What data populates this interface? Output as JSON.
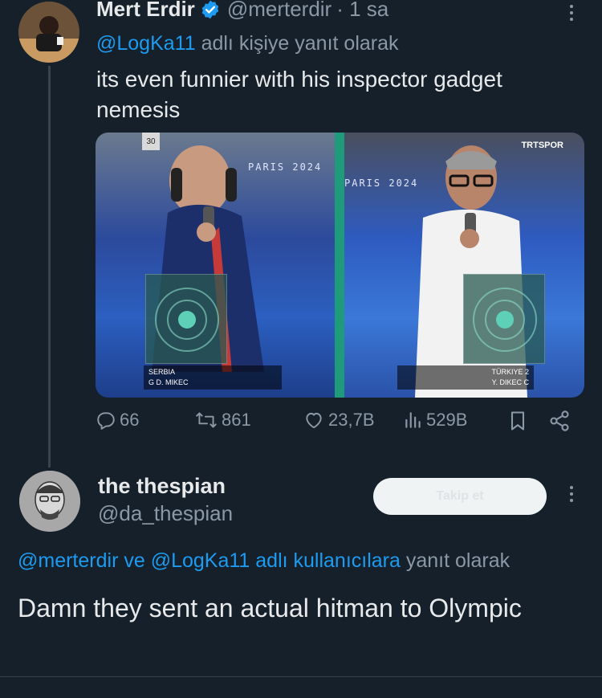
{
  "tweet1": {
    "display_name": "Mert Erdir",
    "handle": "@merterdir",
    "time": "· 1 sa",
    "reply_to_handle": "@LogKa11",
    "reply_to_suffix": " adlı kişiye yanıt olarak",
    "text": "its even funnier with his inspector gadget nemesis",
    "media": {
      "left_banner": "PARIS 2024",
      "right_banner": "PARIS 2024",
      "lane_number": "30",
      "watermark": "TRTSPOR",
      "left_country": "SERBIA",
      "left_athlete": "G D. MIKEC",
      "right_country": "TÜRKIYE 2",
      "right_athlete": "Y. DIKEC C"
    },
    "actions": {
      "replies": "66",
      "reposts": "861",
      "likes": "23,7B",
      "views": "529B"
    }
  },
  "tweet2": {
    "display_name": "the thespian",
    "handle": "@da_thespian",
    "follow_label": "Takip et",
    "reply_context": {
      "mention1": "@merterdir",
      "connector": " ve ",
      "mention2": "@LogKa11",
      "suffix_link": " adlı kullanıcılara",
      "suffix": " yanıt olarak"
    },
    "text": "Damn they sent an actual hitman to Olympic"
  },
  "colors": {
    "background": "#15202b",
    "primary_text": "#e7e9ea",
    "secondary_text": "#8b98a5",
    "accent": "#1d9bf0",
    "verified": "#1d9bf0"
  }
}
